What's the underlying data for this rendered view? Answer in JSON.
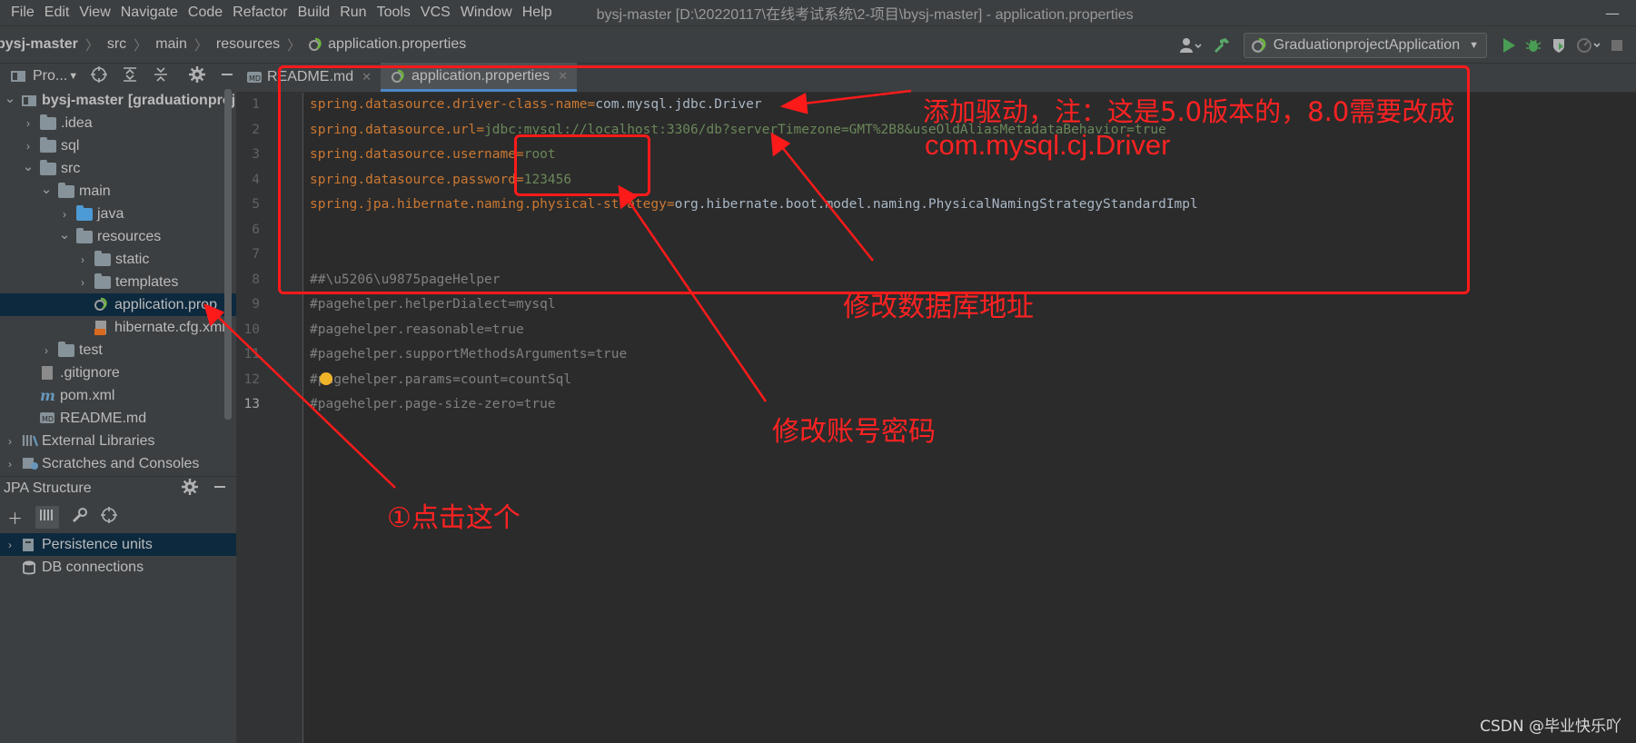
{
  "menubar": {
    "items": [
      "File",
      "Edit",
      "View",
      "Navigate",
      "Code",
      "Refactor",
      "Build",
      "Run",
      "Tools",
      "VCS",
      "Window",
      "Help"
    ],
    "window_title": "bysj-master [D:\\20220117\\在线考试系统\\2-项目\\bysj-master] - application.properties",
    "minimize": "—",
    "maximize": "□"
  },
  "breadcrumb": [
    "bysj-master",
    "src",
    "main",
    "resources",
    "application.properties"
  ],
  "run_config": {
    "label": "GraduationprojectApplication",
    "icons": [
      "user-icon",
      "build-hammer-icon",
      "run-icon",
      "debug-icon",
      "coverage-icon",
      "profile-icon",
      "stop-icon"
    ]
  },
  "project_panel": {
    "title": "Pro...",
    "tree": [
      {
        "label": "bysj-master",
        "suffix": "[graduationproj",
        "depth": 0,
        "expanded": true,
        "type": "project"
      },
      {
        "label": ".idea",
        "depth": 1,
        "expanded": false,
        "type": "folder"
      },
      {
        "label": "sql",
        "depth": 1,
        "expanded": false,
        "type": "folder"
      },
      {
        "label": "src",
        "depth": 1,
        "expanded": true,
        "type": "folder"
      },
      {
        "label": "main",
        "depth": 2,
        "expanded": true,
        "type": "folder"
      },
      {
        "label": "java",
        "depth": 3,
        "expanded": false,
        "type": "folder-blue"
      },
      {
        "label": "resources",
        "depth": 3,
        "expanded": true,
        "type": "folder-res"
      },
      {
        "label": "static",
        "depth": 4,
        "expanded": false,
        "type": "folder"
      },
      {
        "label": "templates",
        "depth": 4,
        "expanded": false,
        "type": "folder"
      },
      {
        "label": "application.prop",
        "depth": 4,
        "type": "file-spring",
        "selected": true
      },
      {
        "label": "hibernate.cfg.xml",
        "depth": 4,
        "type": "file-xml"
      },
      {
        "label": "test",
        "depth": 2,
        "expanded": false,
        "type": "folder"
      },
      {
        "label": ".gitignore",
        "depth": 1,
        "type": "file-git"
      },
      {
        "label": "pom.xml",
        "depth": 1,
        "type": "file-maven"
      },
      {
        "label": "README.md",
        "depth": 1,
        "type": "file-md"
      },
      {
        "label": "External Libraries",
        "depth": 0,
        "expanded": false,
        "type": "libs"
      },
      {
        "label": "Scratches and Consoles",
        "depth": 0,
        "expanded": false,
        "type": "scratch"
      }
    ]
  },
  "jpa_panel": {
    "title": "JPA Structure",
    "tree": [
      {
        "label": "Persistence units",
        "selected": true
      },
      {
        "label": "DB connections"
      }
    ]
  },
  "tabs": [
    {
      "label": "README.md",
      "active": false,
      "icon": "markdown-icon"
    },
    {
      "label": "application.properties",
      "active": true,
      "icon": "spring-properties-icon"
    }
  ],
  "editor": {
    "current_line": 13,
    "lines": [
      {
        "n": "1",
        "key": "spring.datasource.driver-class-name",
        "value": "com.mysql.jdbc.Driver"
      },
      {
        "n": "2",
        "key": "spring.datasource.url",
        "value": "jdbc:mysql://localhost:3306/db?serverTimezone=GMT%2B8&useOldAliasMetadataBehavior=true"
      },
      {
        "n": "3",
        "key": "spring.datasource.username",
        "value": "root"
      },
      {
        "n": "4",
        "key": "spring.datasource.password",
        "value": "123456"
      },
      {
        "n": "5",
        "key": "spring.jpa.hibernate.naming.physical-strategy",
        "value": "org.hibernate.boot.model.naming.PhysicalNamingStrategyStandardImpl"
      },
      {
        "n": "6",
        "key": "",
        "value": ""
      },
      {
        "n": "7",
        "key": "",
        "value": ""
      },
      {
        "n": "8",
        "comment": "##\\u5206\\u9875pageHelper"
      },
      {
        "n": "9",
        "comment": "#pagehelper.helperDialect=mysql"
      },
      {
        "n": "10",
        "comment": "#pagehelper.reasonable=true"
      },
      {
        "n": "11",
        "comment": "#pagehelper.supportMethodsArguments=true"
      },
      {
        "n": "12",
        "comment": "#pagehelper.params=count=countSql"
      },
      {
        "n": "13",
        "comment": "#pagehelper.page-size-zero=true"
      }
    ]
  },
  "annotations": {
    "driver_note_line1": "添加驱动，注：这是5.0版本的，8.0需要改成",
    "driver_note_line2": "com.mysql.cj.Driver",
    "db_url_note": "修改数据库地址",
    "account_note": "修改账号密码",
    "click_note": "①点击这个",
    "color": "#ff1a1a"
  },
  "watermark": "CSDN @毕业快乐吖"
}
